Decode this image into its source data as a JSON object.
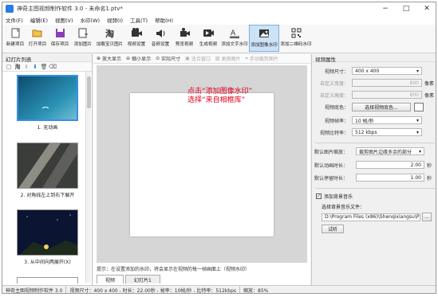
{
  "window": {
    "title": "神奇主图视频制作软件 3.0 - 未命名1.ptv*",
    "controls": [
      "−",
      "□",
      "✕"
    ]
  },
  "menu": [
    "文件(F)",
    "编辑(E)",
    "视图(V)",
    "水印(W)",
    "视频(I)",
    "工具(T)",
    "帮助(H)"
  ],
  "toolbar": [
    {
      "label": "新建项目",
      "icon": "new-project-icon"
    },
    {
      "label": "打开项目",
      "icon": "open-project-icon"
    },
    {
      "label": "保存项目",
      "icon": "save-project-icon"
    },
    {
      "label": "添加图片",
      "icon": "add-image-icon"
    },
    {
      "label": "加载宝贝图片",
      "icon": "load-product-image-icon"
    },
    {
      "label": "视频设置",
      "icon": "video-settings-icon"
    },
    {
      "label": "音频设置",
      "icon": "audio-settings-icon"
    },
    {
      "label": "预览视频",
      "icon": "preview-video-icon"
    },
    {
      "label": "生成视频",
      "icon": "generate-video-icon"
    },
    {
      "label": "添加文字水印",
      "icon": "text-watermark-icon"
    },
    {
      "label": "添加图像水印",
      "icon": "image-watermark-icon",
      "active": true
    },
    {
      "label": "添加二维码水印",
      "icon": "qrcode-watermark-icon"
    }
  ],
  "left_panel": {
    "title": "幻灯片列表",
    "slides": [
      {
        "caption": "1. 无动画"
      },
      {
        "caption": "2. 对角线左上到右下展开"
      },
      {
        "caption": "3. 从中间向两展开(X)"
      }
    ]
  },
  "center": {
    "toolbar": [
      {
        "label": "放大显示",
        "icon": "zoom-in-icon",
        "enabled": true
      },
      {
        "label": "缩小显示",
        "icon": "zoom-out-icon",
        "enabled": true
      },
      {
        "label": "实际尺寸",
        "icon": "actual-size-icon",
        "enabled": true
      },
      {
        "label": "适合窗口",
        "icon": "fit-window-icon",
        "enabled": false
      },
      {
        "label": "更换图片",
        "icon": "replace-image-icon",
        "enabled": false
      },
      {
        "label": "手动裁剪图片",
        "icon": "crop-icon",
        "enabled": false
      }
    ],
    "annotation": [
      "点击“添加图像水印”",
      "选择“来自相框库”"
    ],
    "hint": "提示：在设置添加的水印，将会显示在视频的每一帧画面上（视频水印）",
    "tabs": [
      "视频",
      "幻灯片1"
    ]
  },
  "right_panel": {
    "title": "视频属性",
    "video_size_label": "视频尺寸：",
    "video_size_value": "400 x 400",
    "custom_width_label": "自定义宽度：",
    "custom_width_value": "800",
    "custom_height_label": "自定义高度：",
    "custom_height_value": "800",
    "unit_pixel": "像素",
    "video_color_label": "视频底色：",
    "video_color_button": "选择视频底色...",
    "video_color_swatch": "#ffffff",
    "frame_rate_label": "视频帧率：",
    "frame_rate_value": "10 帧/秒",
    "bitrate_label": "视频比特率：",
    "bitrate_value": "512 kbps",
    "image_scale_label": "默认图片缩放：",
    "image_scale_value": "裁剪图片边缘多余的部分",
    "anim_duration_label": "默认动画时长：",
    "anim_duration_value": "2.00",
    "stay_duration_label": "默认停留时长：",
    "stay_duration_value": "1.00",
    "unit_second": "秒",
    "add_bgm_label": "添加背景音乐",
    "add_bgm_checked": true,
    "bgm_file_label": "选择背景音乐文件：",
    "bgm_file_value": "D:\\Program Files (x86)\\Shenqixiangsu\\Phot ...",
    "bgm_browse": "...",
    "audition_button": "试听"
  },
  "status": {
    "app": "神奇主图视频制作软件 3.0",
    "video_size": "视频尺寸：400 x 400",
    "duration": "时长：22.00秒",
    "frame_rate": "帧率：10帧/秒",
    "bitrate": "比特率：512kbps",
    "zoom": "缩放：85%"
  }
}
